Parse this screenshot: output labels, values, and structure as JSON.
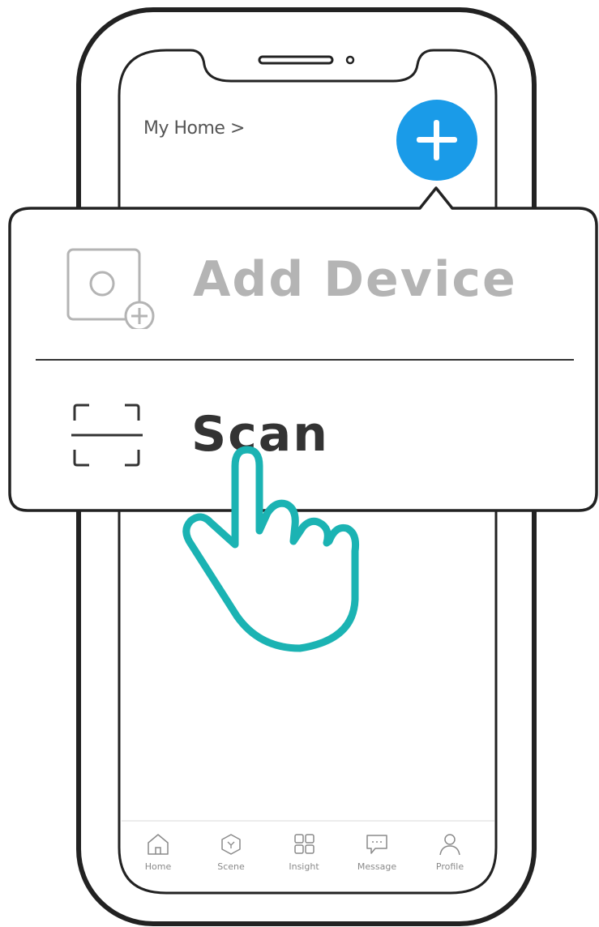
{
  "header": {
    "home_label": "My Home >"
  },
  "menu": {
    "add_device_label": "Add Device",
    "scan_label": "Scan"
  },
  "tabs": [
    {
      "label": "Home",
      "icon": "home-icon"
    },
    {
      "label": "Scene",
      "icon": "scene-icon"
    },
    {
      "label": "Insight",
      "icon": "insight-icon"
    },
    {
      "label": "Message",
      "icon": "message-icon"
    },
    {
      "label": "Profile",
      "icon": "profile-icon"
    }
  ],
  "colors": {
    "accent": "#1a9be8",
    "hand": "#1bb3b3",
    "outline": "#222222",
    "muted": "#b4b4b4"
  }
}
